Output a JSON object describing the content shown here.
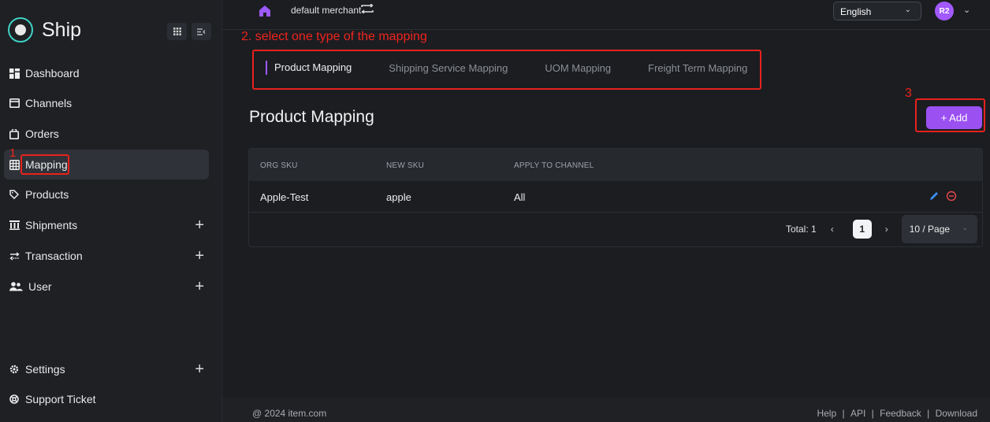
{
  "brand": {
    "name": "Ship"
  },
  "sidebar": {
    "items": [
      {
        "label": "Dashboard",
        "icon": "dashboard-icon"
      },
      {
        "label": "Channels",
        "icon": "channels-icon"
      },
      {
        "label": "Orders",
        "icon": "orders-icon"
      },
      {
        "label": "Mapping",
        "icon": "mapping-icon"
      },
      {
        "label": "Products",
        "icon": "products-icon"
      },
      {
        "label": "Shipments",
        "icon": "shipments-icon",
        "expandable": true
      },
      {
        "label": "Transaction",
        "icon": "transaction-icon",
        "expandable": true
      },
      {
        "label": "User",
        "icon": "user-icon",
        "expandable": true
      },
      {
        "label": "Settings",
        "icon": "settings-icon",
        "expandable": true
      },
      {
        "label": "Support Ticket",
        "icon": "support-icon"
      }
    ],
    "plus": "+"
  },
  "topbar": {
    "merchant": "default merchant",
    "language": "English",
    "avatar": "R2"
  },
  "annotations": {
    "step1": "1",
    "step2": "2. select one type of the mapping",
    "step3": "3"
  },
  "tabs": [
    {
      "label": "Product Mapping",
      "active": true
    },
    {
      "label": "Shipping Service Mapping"
    },
    {
      "label": "UOM Mapping"
    },
    {
      "label": "Freight Term Mapping"
    }
  ],
  "main": {
    "title": "Product Mapping",
    "add_label": "+ Add"
  },
  "table": {
    "headers": [
      "ORG SKU",
      "NEW SKU",
      "APPLY TO CHANNEL"
    ],
    "rows": [
      [
        "Apple-Test",
        "apple",
        "All"
      ]
    ]
  },
  "pagination": {
    "total": "Total: 1",
    "current_page": "1",
    "page_size": "10 / Page",
    "prev": "‹",
    "next": "›"
  },
  "footer": {
    "copyright": "@ 2024 item.com",
    "links": [
      "Help",
      "API",
      "Feedback",
      "Download"
    ],
    "separator": "|"
  },
  "colors": {
    "accent": "#9b51f2",
    "annotation": "#e8221c",
    "background": "#1b1d21"
  }
}
